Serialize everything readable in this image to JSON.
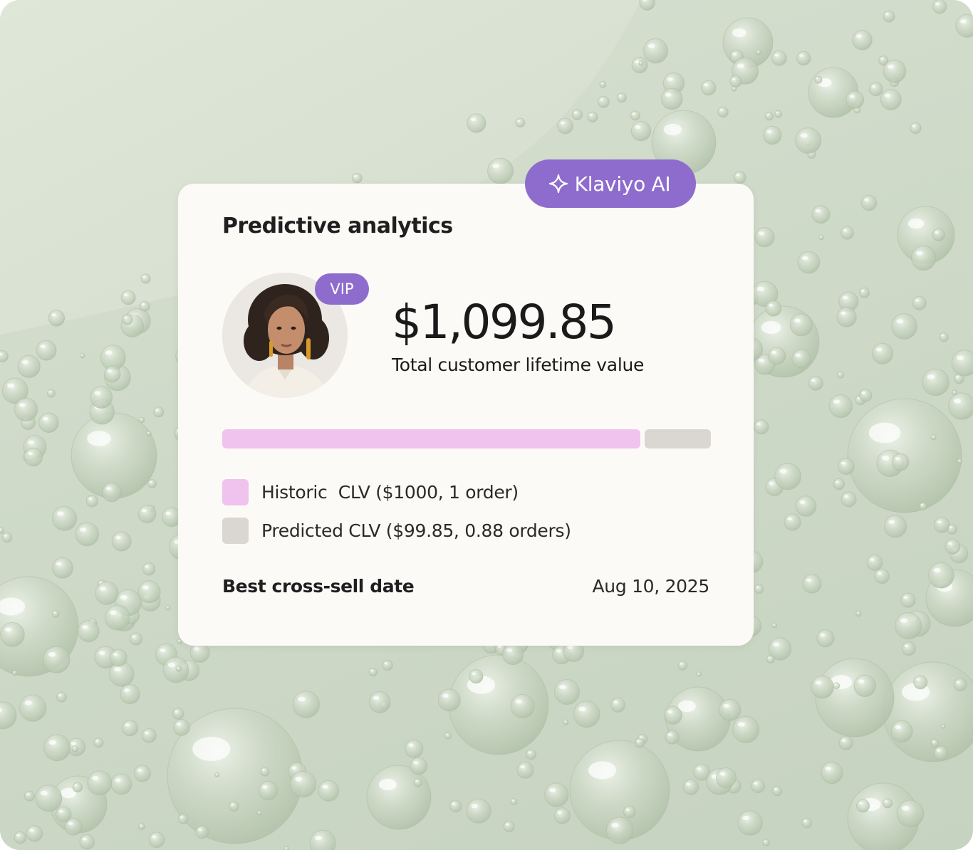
{
  "colors": {
    "accent_purple": "#8e6ccd",
    "historic_bar": "#f0c2ee",
    "predicted_bar": "#dad7d3",
    "card_bg": "#fcfaf7",
    "background": "#cfdac9"
  },
  "badge": {
    "label": "Klaviyo AI",
    "icon": "sparkle-icon"
  },
  "card": {
    "title": "Predictive analytics",
    "profile": {
      "avatar": "customer-avatar",
      "tag": "VIP"
    },
    "clv": {
      "total": "$1,099.85",
      "total_label": "Total customer lifetime value",
      "historic_share": 0.855
    },
    "legend": [
      {
        "label": "Historic  CLV ($1000, 1 order)",
        "color": "#f0c2ee"
      },
      {
        "label": "Predicted CLV ($99.85, 0.88 orders)",
        "color": "#dad7d3"
      }
    ],
    "cross_sell": {
      "label": "Best cross-sell date",
      "value": "Aug 10, 2025"
    }
  }
}
